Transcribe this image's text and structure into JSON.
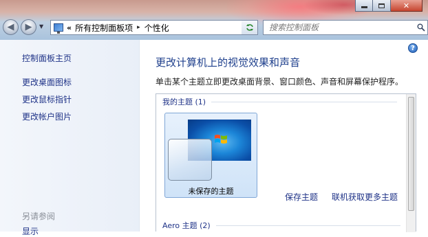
{
  "window": {
    "controls": {
      "minimize_icon": "minimize-icon",
      "maximize_icon": "maximize-icon",
      "close_icon": "close-icon"
    }
  },
  "nav": {
    "back_icon": "back-arrow-icon",
    "forward_icon": "forward-arrow-icon"
  },
  "address": {
    "overflow_chevron": "«",
    "crumbs": [
      "所有控制面板项",
      "个性化"
    ],
    "separator": "▸"
  },
  "search": {
    "placeholder": "搜索控制面板"
  },
  "sidebar": {
    "home": "控制面板主页",
    "items": [
      "更改桌面图标",
      "更改鼠标指针",
      "更改帐户图片"
    ],
    "see_also": "另请参阅",
    "see_also_items": [
      "显示"
    ]
  },
  "main": {
    "help": "?",
    "title": "更改计算机上的视觉效果和声音",
    "description": "单击某个主题立即更改桌面背景、窗口颜色、声音和屏幕保护程序。",
    "groups": [
      {
        "label": "我的主题 (1)"
      },
      {
        "label": "Aero 主题 (2)"
      }
    ],
    "themes": [
      {
        "name": "未保存的主题",
        "selected": true
      }
    ],
    "actions": {
      "save_theme": "保存主题",
      "get_more": "联机获取更多主题"
    }
  },
  "colors": {
    "link": "#1e3287",
    "heading": "#1e3f8c",
    "selection": "#cfe3f8"
  }
}
